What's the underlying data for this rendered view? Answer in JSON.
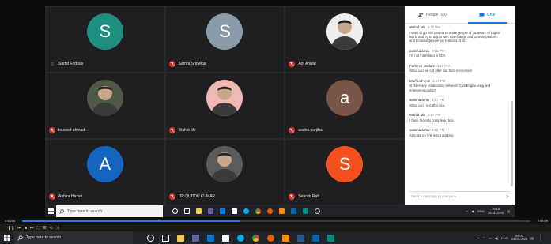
{
  "meet": {
    "participants": [
      {
        "name": "Sadaf Firdous",
        "initial": "S",
        "color": "#1e8e7e",
        "muted": false,
        "kind": "initial"
      },
      {
        "name": "Samra Showkat",
        "initial": "S",
        "color": "#8a9aa8",
        "muted": true,
        "kind": "initial"
      },
      {
        "name": "Arif Anwar",
        "initial": "",
        "color": "#eeeeee",
        "muted": true,
        "kind": "photo"
      },
      {
        "name": "touseef ahmad",
        "initial": "",
        "color": "#4f5a45",
        "muted": true,
        "kind": "photo"
      },
      {
        "name": "Wahid Mir",
        "initial": "",
        "color": "#f1b9b3",
        "muted": true,
        "kind": "photo"
      },
      {
        "name": "aadira purjiba",
        "initial": "a",
        "color": "#7a5548",
        "muted": true,
        "kind": "initial"
      },
      {
        "name": "Aabira Hazari",
        "initial": "A",
        "color": "#1565c0",
        "muted": true,
        "kind": "initial"
      },
      {
        "name": "DR.QUDDU KUMAR",
        "initial": "",
        "color": "#5b5b5b",
        "muted": true,
        "kind": "photo"
      },
      {
        "name": "Sehrab Rafi",
        "initial": "S",
        "color": "#f4511e",
        "muted": true,
        "kind": "initial"
      }
    ]
  },
  "chat": {
    "tab_people": "People (59)",
    "tab_chat": "Chat",
    "messages": [
      {
        "sender": "Wahid Mir",
        "time": "4:15 PM",
        "text": "I want to go with project to make people of J& aware of Digital world and try to adjust with this change and provide platform and knowledge to enjoy features of iot"
      },
      {
        "sender": "samina amin",
        "time": "4:16 PM",
        "text": "i'm not interested in bCA"
      },
      {
        "sender": "Farheen Jeelani",
        "time": "4:17 PM",
        "text": "What can we opt after bsc from economics"
      },
      {
        "sender": "Marfoo Feroz",
        "time": "4:17 PM",
        "text": "Is there any relationship between Civil Engineering and entrepreneurship?"
      },
      {
        "sender": "samina amin",
        "time": "4:17 PM",
        "text": "What can i opt after bca"
      },
      {
        "sender": "Wahid Mir",
        "time": "4:17 PM",
        "text": "I have recently completed bca"
      },
      {
        "sender": "samina amin",
        "time": "4:18 PM",
        "text": "Attendance link is not working"
      }
    ],
    "input_placeholder": "Send a message to everyone"
  },
  "inner_taskbar": {
    "search_placeholder": "Type here to search",
    "clock_time": "16:18",
    "clock_date": "26-11-2020",
    "lang": "ENG"
  },
  "player": {
    "elapsed": "0:53:56",
    "total": "2:04:09",
    "progress": 0.43
  },
  "taskbar": {
    "search_placeholder": "Type here to search",
    "clock_time": "08:51",
    "clock_date": "04-03-2021",
    "lang": "ENG"
  },
  "colors": {
    "meet_bg": "#1f1f22",
    "accent": "#1a73e8",
    "mute_red": "#d93025"
  }
}
